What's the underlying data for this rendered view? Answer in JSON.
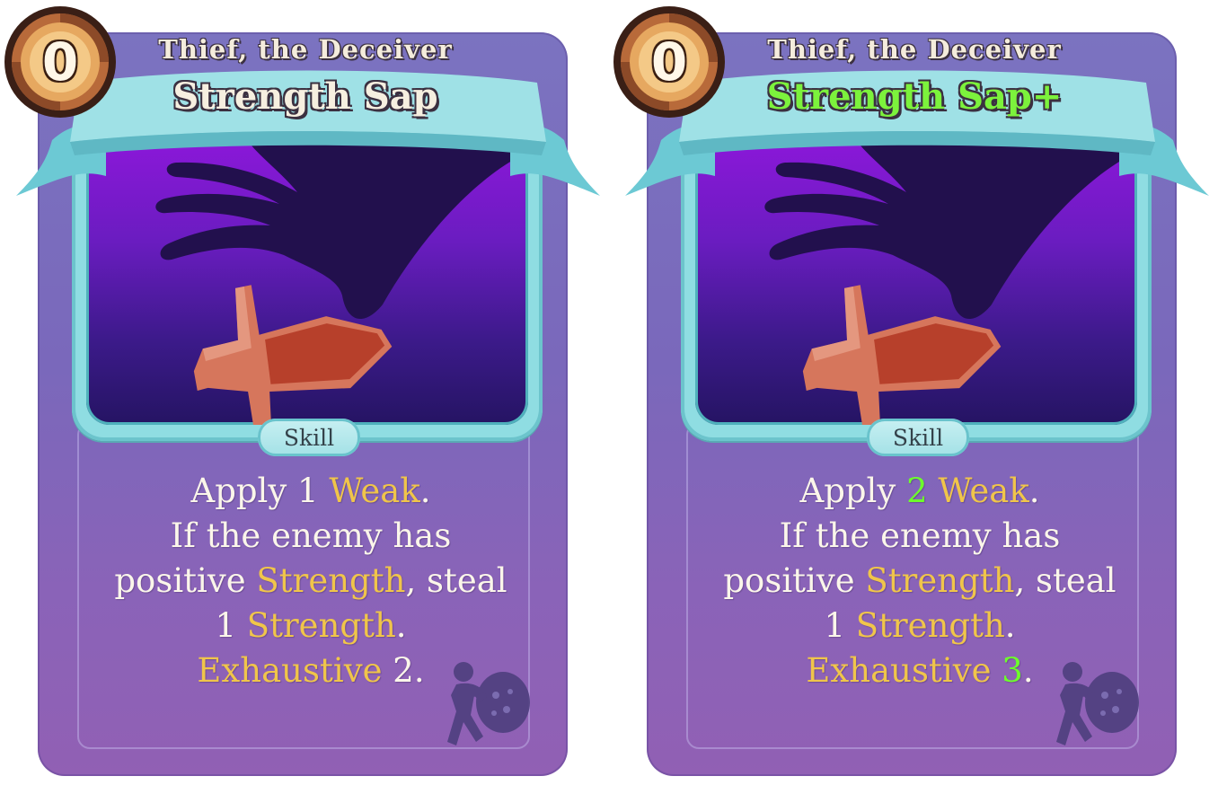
{
  "cards": [
    {
      "energy_cost": "0",
      "character": "Thief, the Deceiver",
      "title": "Strength Sap",
      "card_type": "Skill",
      "description": {
        "line1_a": "Apply 1 ",
        "line1_kw": "Weak",
        "line1_end": ".",
        "line2": "If the enemy has",
        "line3_a": "positive ",
        "line3_kw": "Strength",
        "line3_b": ", steal",
        "line4_a": "1 ",
        "line4_kw": "Strength",
        "line4_end": ".",
        "line5_kw": "Exhaustive",
        "line5_val": " 2",
        "line5_end": "."
      },
      "upgraded": false
    },
    {
      "energy_cost": "0",
      "character": "Thief, the Deceiver",
      "title": "Strength Sap+",
      "card_type": "Skill",
      "description": {
        "line1_a": "Apply ",
        "line1_val": "2",
        "line1_kw": " Weak",
        "line1_end": ".",
        "line2": "If the enemy has",
        "line3_a": "positive ",
        "line3_kw": "Strength",
        "line3_b": ", steal",
        "line4_a": "1 ",
        "line4_kw": "Strength",
        "line4_end": ".",
        "line5_kw": "Exhaustive",
        "line5_val": " 3",
        "line5_end": "."
      },
      "upgraded": true
    }
  ],
  "colors": {
    "keyword": "#f0c54a",
    "upgrade_value": "#6dff2b",
    "upgraded_title": "#7cf23c",
    "card_purple": "#7b73c0",
    "frame_cyan": "#8fdde2"
  },
  "icons": {
    "energy": "energy-orb-icon",
    "art": "hand-grabbing-sword-icon",
    "class": "thief-with-sack-icon"
  }
}
